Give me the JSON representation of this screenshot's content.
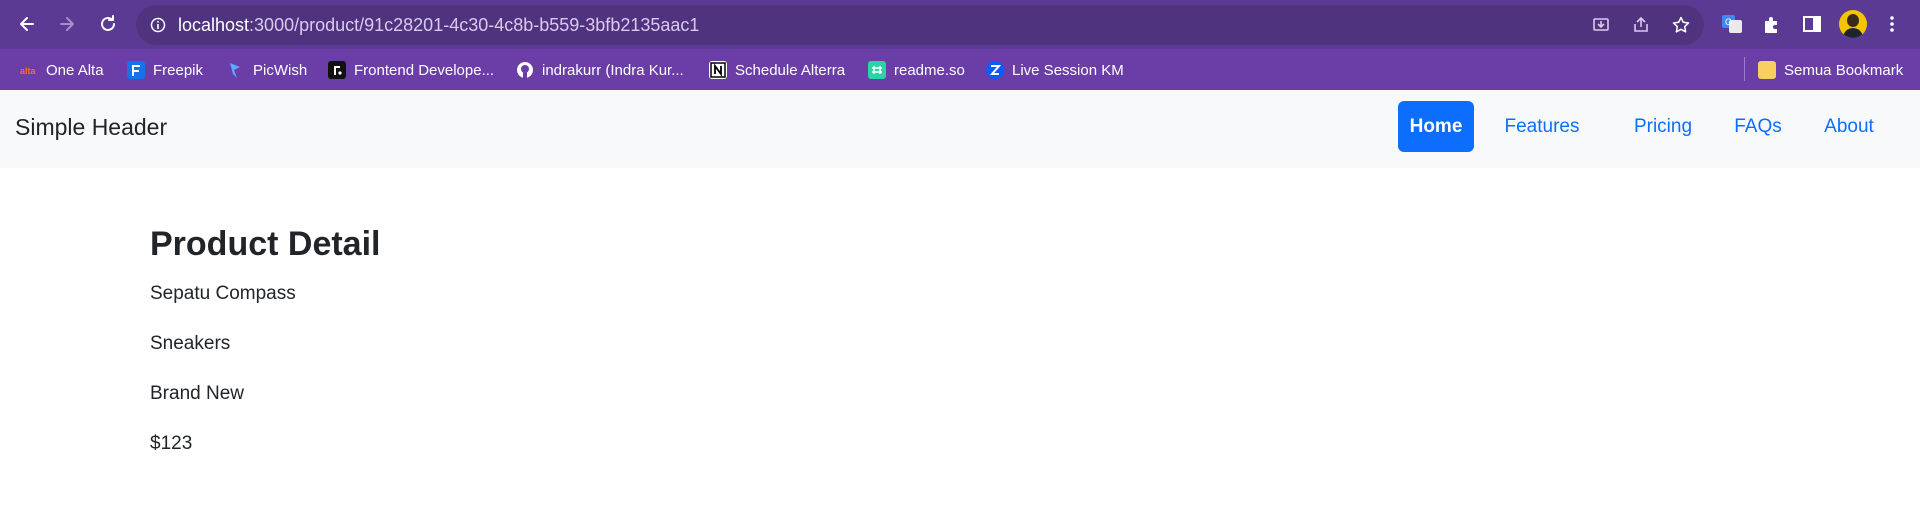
{
  "browser": {
    "url_host": "localhost",
    "url_rest": ":3000/product/91c28201-4c30-4c8b-b559-3bfb2135aac1",
    "colors": {
      "toolbar": "#5b3a93",
      "omnibox": "#4f337f",
      "bookmarks_bar": "#6a3ea6"
    }
  },
  "bookmarks": {
    "items": [
      {
        "label": "One Alta",
        "icon": "alta-icon"
      },
      {
        "label": "Freepik",
        "icon": "freepik-icon"
      },
      {
        "label": "PicWish",
        "icon": "picwish-icon"
      },
      {
        "label": "Frontend Develope...",
        "icon": "frontend-mentor-icon"
      },
      {
        "label": "indrakurr (Indra Kur...",
        "icon": "github-icon"
      },
      {
        "label": "Schedule Alterra",
        "icon": "notion-icon"
      },
      {
        "label": "readme.so",
        "icon": "readme-icon"
      },
      {
        "label": "Live Session KM",
        "icon": "zoom-icon"
      }
    ],
    "all_bookmarks": "Semua Bookmark"
  },
  "header": {
    "brand": "Simple Header",
    "nav": [
      {
        "label": "Home",
        "active": true
      },
      {
        "label": "Features",
        "active": false
      },
      {
        "label": "Pricing",
        "active": false
      },
      {
        "label": "FAQs",
        "active": false
      },
      {
        "label": "About",
        "active": false
      }
    ],
    "colors": {
      "primary": "#0d6efd",
      "background": "#f8f9fa"
    }
  },
  "product": {
    "heading": "Product Detail",
    "name": "Sepatu Compass",
    "category": "Sneakers",
    "condition": "Brand New",
    "price": "$123"
  }
}
